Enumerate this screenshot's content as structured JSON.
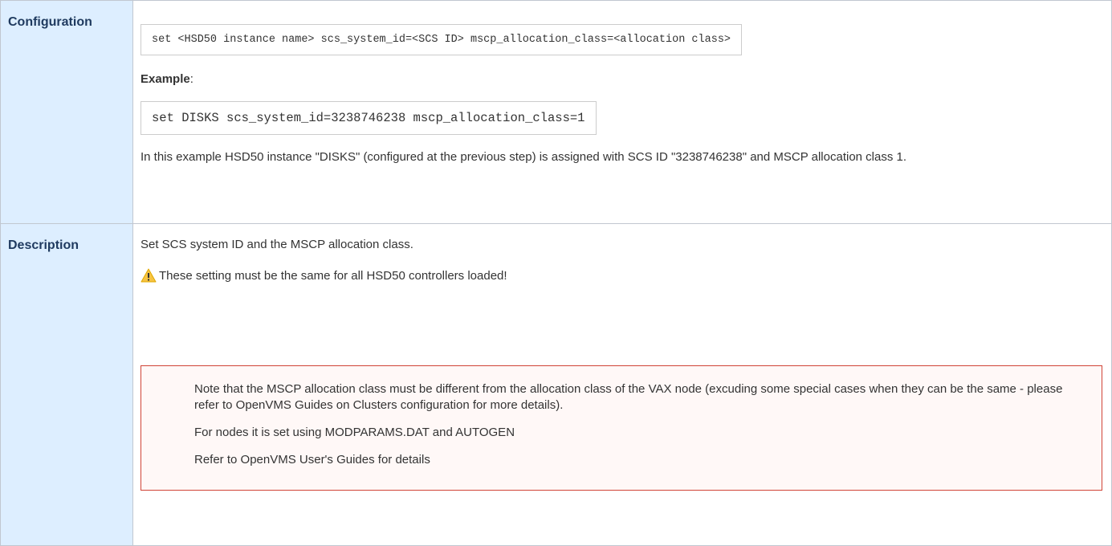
{
  "rows": {
    "configuration": {
      "header": "Configuration",
      "syntax_code": "set <HSD50 instance name> scs_system_id=<SCS ID> mscp_allocation_class=<allocation class>",
      "example_label": "Example",
      "example_colon": ":",
      "example_code": "set DISKS scs_system_id=3238746238 mscp_allocation_class=1",
      "explanation": "In this example HSD50 instance \"DISKS\" (configured at the previous step) is assigned with SCS ID \"3238746238\" and MSCP allocation class 1."
    },
    "description": {
      "header": "Description",
      "summary": "Set SCS system ID and the MSCP allocation class.",
      "warning_icon": "warning-icon",
      "warning_text": "These setting must be the same for all HSD50 controllers loaded!",
      "note": {
        "paragraphs": [
          "Note that the MSCP allocation class must be different from the allocation class of the VAX node (excuding some special cases when they can be the same - please refer to OpenVMS Guides on Clusters configuration for more details).",
          "For nodes it is set using MODPARAMS.DAT and AUTOGEN",
          "Refer to OpenVMS User's Guides for details"
        ]
      }
    }
  },
  "colors": {
    "header_bg": "#ddeeff",
    "header_text": "#1f3a5f",
    "border": "#c1c7d0",
    "note_border": "#d04437",
    "note_bg": "#fff8f7",
    "warning_yellow": "#f6c342"
  }
}
